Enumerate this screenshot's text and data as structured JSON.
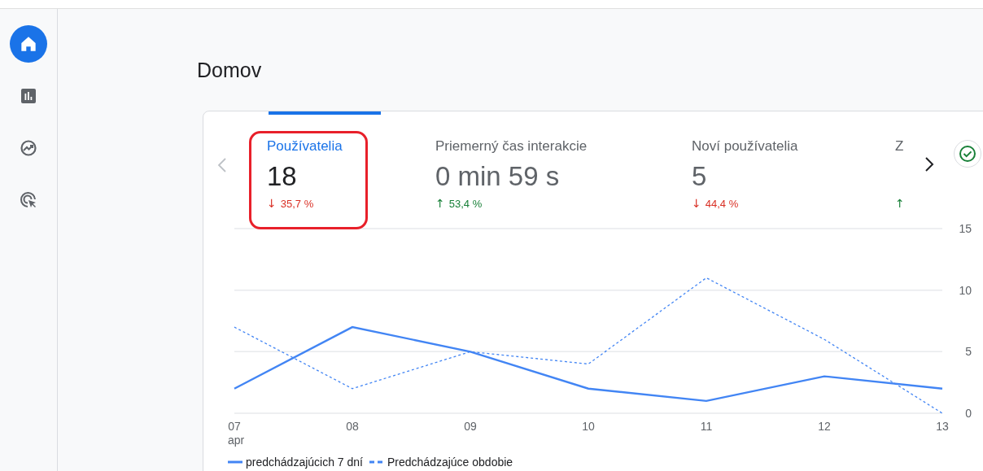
{
  "sidebar": {
    "items": [
      {
        "kind": "home",
        "selected": true
      },
      {
        "kind": "reports",
        "selected": false
      },
      {
        "kind": "explore",
        "selected": false
      },
      {
        "kind": "advertising",
        "selected": false
      }
    ]
  },
  "page_title": "Domov",
  "metrics": [
    {
      "label": "Používatelia",
      "value": "18",
      "arrow": "↓",
      "change": "35,7 %",
      "color": "#d93025",
      "selected": true,
      "highlighted": true
    },
    {
      "label": "Priemerný čas interakcie",
      "value": "0 min 59 s",
      "arrow": "↑",
      "change": "53,4 %",
      "color": "#188038",
      "selected": false,
      "highlighted": false
    },
    {
      "label": "Noví používatelia",
      "value": "5",
      "arrow": "↓",
      "change": "44,4 %",
      "color": "#d93025",
      "selected": false,
      "highlighted": false
    },
    {
      "label": "Z",
      "arrow": "↑",
      "color": "#188038",
      "selected": false,
      "highlighted": false
    }
  ],
  "chart": {
    "month_label": "apr",
    "chart_data": {
      "type": "line",
      "categories": [
        "07",
        "08",
        "09",
        "10",
        "11",
        "12",
        "13"
      ],
      "ylim": [
        0,
        15
      ],
      "yticks": [
        0,
        5,
        10,
        15
      ],
      "legend": "bottom",
      "series": [
        {
          "name": "predchádzajúcich 7 dní",
          "color": "#4285f4",
          "line_style": "solid",
          "values": [
            2,
            7,
            5,
            2,
            1,
            3,
            2
          ]
        },
        {
          "name": "Predchádzajúce obdobie",
          "color": "#4285f4",
          "line_style": "dashed",
          "values": [
            7,
            2,
            5,
            4,
            11,
            6,
            0
          ]
        }
      ]
    }
  }
}
